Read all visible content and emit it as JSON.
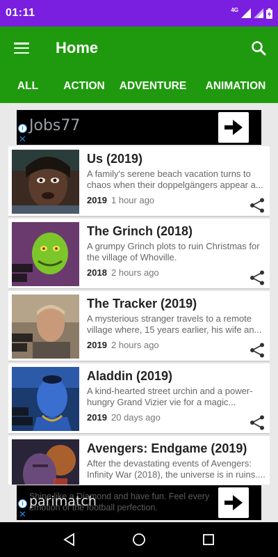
{
  "status": {
    "time": "01:11",
    "network": "4G"
  },
  "app": {
    "title": "Home"
  },
  "tabs": [
    {
      "label": "ALL"
    },
    {
      "label": "ACTION"
    },
    {
      "label": "ADVENTURE"
    },
    {
      "label": "ANIMATION"
    }
  ],
  "ad_top": {
    "brand": "Jobs77",
    "info_icon": "info-icon",
    "close_icon": "close-icon",
    "button_icon": "arrow-right-icon"
  },
  "movies": [
    {
      "title": "Us (2019)",
      "description": "A family's serene beach vacation turns to chaos when their doppelgängers appear a...",
      "year": "2019",
      "time": "1 hour ago"
    },
    {
      "title": "The Grinch (2018)",
      "description": "A grumpy Grinch plots to ruin Christmas for the village of Whoville.",
      "year": "2018",
      "time": "2 hours ago"
    },
    {
      "title": "The Tracker (2019)",
      "description": "A mysterious stranger travels to a remote village where, 15 years earlier, his wife an...",
      "year": "2019",
      "time": "2 hours ago"
    },
    {
      "title": "Aladdin (2019)",
      "description": "A kind-hearted street urchin and a power-hungry Grand Vizier vie for a magic...",
      "year": "2019",
      "time": "20 days ago"
    },
    {
      "title": "Avengers: Endgame (2019)",
      "description": "After the devastating events of Avengers: Infinity War (2018), the universe is in ruins....",
      "year": "",
      "time": ""
    }
  ],
  "ad_bottom": {
    "brand": "parimatch",
    "text": "Shine like a Diamond and have fun. Feel every emotion of the football perfection."
  },
  "colors": {
    "status_bar": "#7a1fe0",
    "app_bar": "#1f9a0e",
    "ad_background": "#000000"
  }
}
